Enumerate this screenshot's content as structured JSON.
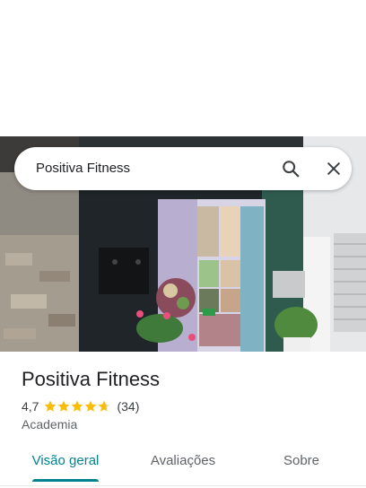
{
  "search": {
    "query": "Positiva Fitness",
    "search_icon": "search-icon",
    "close_icon": "close-icon"
  },
  "place": {
    "name": "Positiva Fitness",
    "rating": "4,7",
    "stars": 4.7,
    "review_count": "(34)",
    "category": "Academia"
  },
  "tabs": [
    {
      "label": "Visão geral",
      "active": true
    },
    {
      "label": "Avaliações",
      "active": false
    },
    {
      "label": "Sobre",
      "active": false
    }
  ],
  "colors": {
    "accent": "#00838f",
    "star": "#fbbc04",
    "star_empty": "#dadce0",
    "text_primary": "#202124",
    "text_secondary": "#5f6368"
  }
}
